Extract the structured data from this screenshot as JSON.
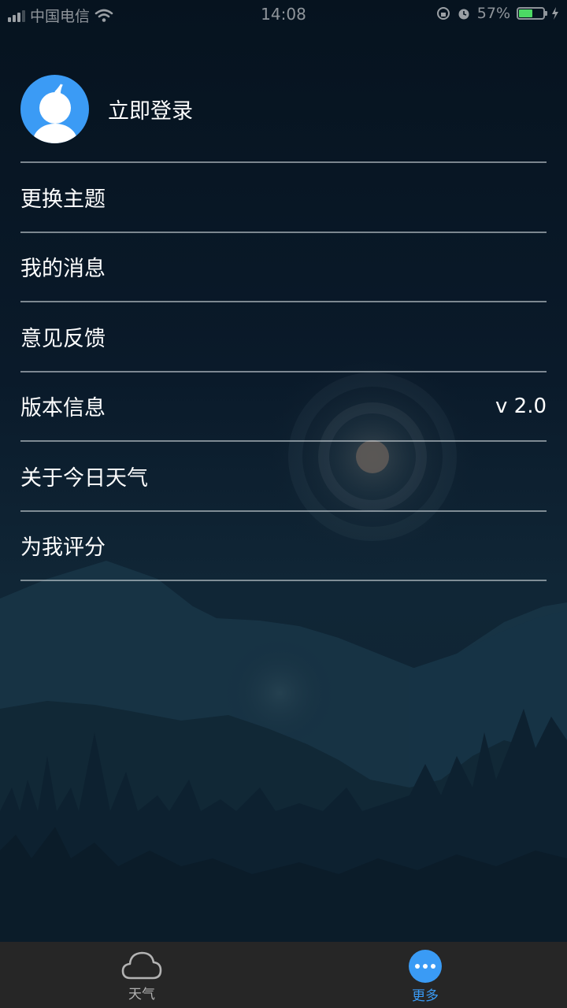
{
  "status_bar": {
    "carrier": "中国电信",
    "time": "14:08",
    "battery_percent": "57%",
    "battery_level": 0.57
  },
  "profile": {
    "login_label": "立即登录"
  },
  "menu": {
    "items": [
      {
        "label": "更换主题",
        "value": ""
      },
      {
        "label": "我的消息",
        "value": ""
      },
      {
        "label": "意见反馈",
        "value": ""
      },
      {
        "label": "版本信息",
        "value": "v 2.0"
      },
      {
        "label": "关于今日天气",
        "value": ""
      },
      {
        "label": "为我评分",
        "value": ""
      }
    ]
  },
  "tab_bar": {
    "tabs": [
      {
        "label": "天气",
        "icon": "cloud-icon",
        "active": false
      },
      {
        "label": "更多",
        "icon": "more-icon",
        "active": true
      }
    ]
  },
  "colors": {
    "accent": "#3a9bf5",
    "tab_bar_bg": "#262626",
    "battery": "#4cd964"
  }
}
